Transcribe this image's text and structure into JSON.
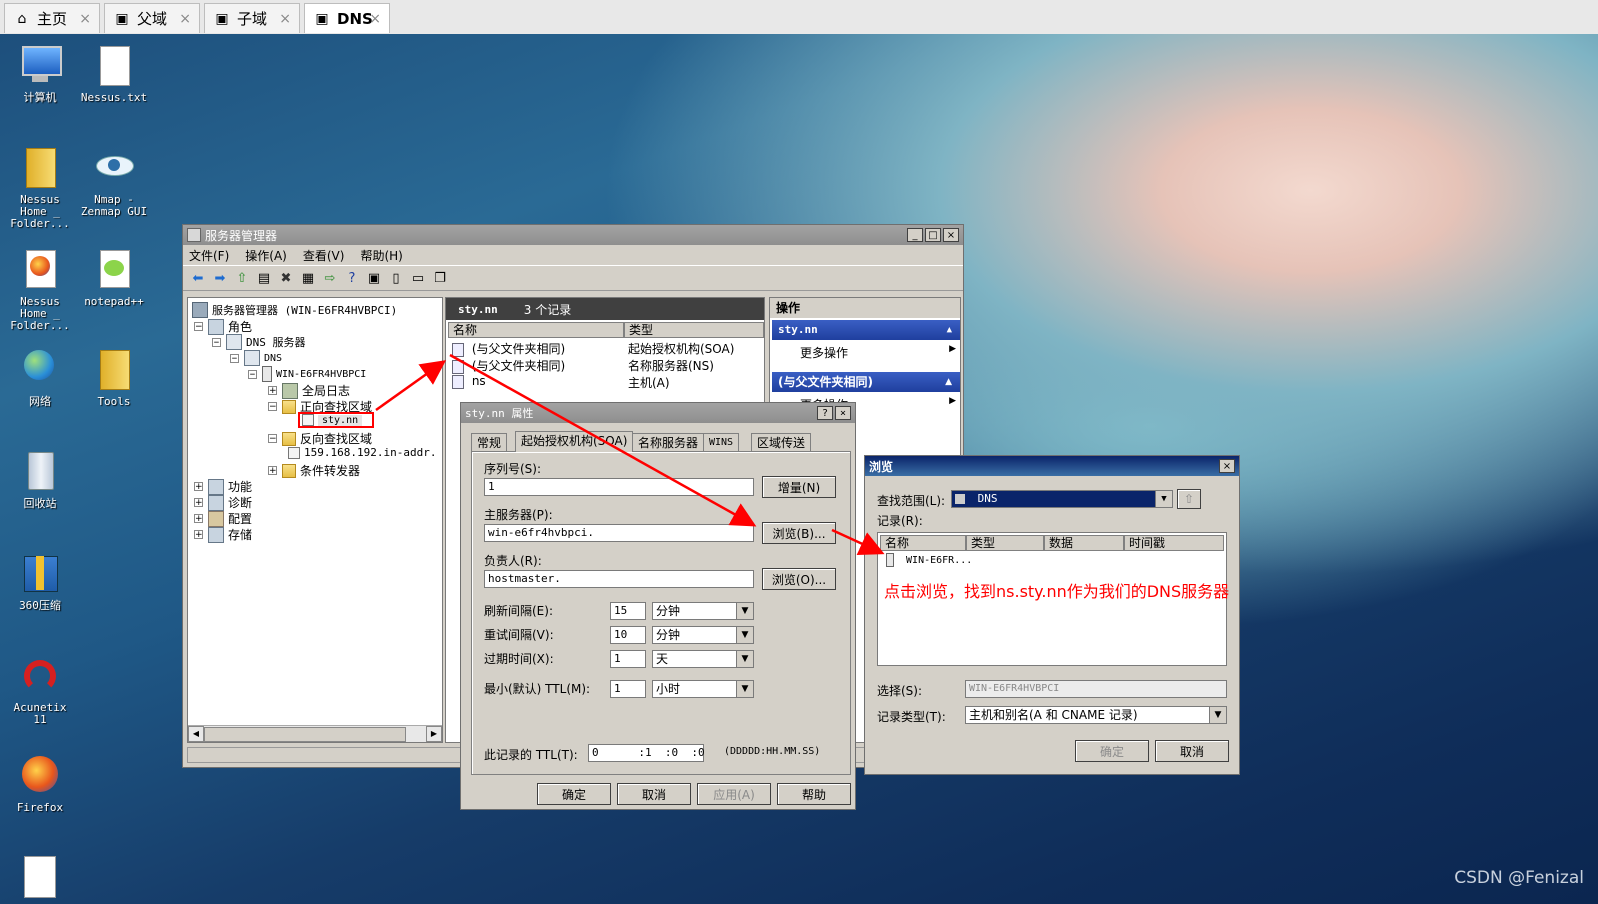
{
  "browser_tabs": [
    {
      "label": "主页",
      "icon": "home-icon",
      "active": false
    },
    {
      "label": "父域",
      "icon": "vm-icon",
      "active": false
    },
    {
      "label": "子域",
      "icon": "vm-icon",
      "active": false
    },
    {
      "label": "DNS",
      "icon": "vm-icon",
      "active": true
    }
  ],
  "desktop_icons": [
    {
      "label": "计算机",
      "icon": "computer-icon"
    },
    {
      "label": "Nessus.txt",
      "icon": "text-file-icon"
    },
    {
      "label": "Nessus Home _ Folder...",
      "icon": "folder-icon"
    },
    {
      "label": "Nmap - Zenmap GUI",
      "icon": "eye-icon"
    },
    {
      "label": "Nessus Home _ Folder...",
      "icon": "firefox-icon"
    },
    {
      "label": "notepad++",
      "icon": "notepad-icon"
    },
    {
      "label": "网络",
      "icon": "network-icon"
    },
    {
      "label": "Tools",
      "icon": "folder-icon"
    },
    {
      "label": "回收站",
      "icon": "recycle-bin-icon"
    },
    {
      "label": "360压缩",
      "icon": "archive-icon"
    },
    {
      "label": "Acunetix 11",
      "icon": "acunetix-icon"
    },
    {
      "label": "Firefox",
      "icon": "firefox-icon"
    }
  ],
  "server_manager": {
    "title": "服务器管理器",
    "menu": [
      "文件(F)",
      "操作(A)",
      "查看(V)",
      "帮助(H)"
    ],
    "tree": {
      "root": "服务器管理器 (WIN-E6FR4HVBPCI)",
      "roles": "角色",
      "dns_service": "DNS 服务器",
      "dns": "DNS",
      "server": "WIN-E6FR4HVBPCI",
      "global_log": "全局日志",
      "forward_zone": "正向查找区域",
      "zone_sty": "sty.nn",
      "reverse_zone": "反向查找区域",
      "reverse_entry": "159.168.192.in-addr.",
      "forwarders": "条件转发器",
      "features": "功能",
      "diagnostics": "诊断",
      "config": "配置",
      "storage": "存储"
    },
    "center": {
      "zone_name": "sty.nn",
      "count": "3 个记录",
      "col_name": "名称",
      "col_type": "类型",
      "records": [
        {
          "name": "(与父文件夹相同)",
          "type": "起始授权机构(SOA)"
        },
        {
          "name": "(与父文件夹相同)",
          "type": "名称服务器(NS)"
        },
        {
          "name": "ns",
          "type": "主机(A)"
        }
      ]
    },
    "actions": {
      "header": "操作",
      "section1": "sty.nn",
      "more1": "更多操作",
      "section2": "(与父文件夹相同)",
      "more2": "更多操作"
    }
  },
  "props_dialog": {
    "title": "sty.nn 属性",
    "tabs": [
      "常规",
      "起始授权机构(SOA)",
      "名称服务器",
      "WINS",
      "区域传送"
    ],
    "serial_label": "序列号(S):",
    "serial_value": "1",
    "increment_btn": "增量(N)",
    "primary_label": "主服务器(P):",
    "primary_value": "win-e6fr4hvbpci.",
    "browse_b": "浏览(B)...",
    "responsible_label": "负责人(R):",
    "responsible_value": "hostmaster.",
    "browse_o": "浏览(O)...",
    "refresh_label": "刷新间隔(E):",
    "refresh_value": "15",
    "refresh_unit": "分钟",
    "retry_label": "重试间隔(V):",
    "retry_value": "10",
    "retry_unit": "分钟",
    "expire_label": "过期时间(X):",
    "expire_value": "1",
    "expire_unit": "天",
    "minttl_label": "最小(默认) TTL(M):",
    "minttl_value": "1",
    "minttl_unit": "小时",
    "ttl_label": "此记录的 TTL(T):",
    "ttl_value": "0      :1  :0  :0",
    "ttl_format": "(DDDDD:HH.MM.SS)",
    "ok": "确定",
    "cancel": "取消",
    "apply": "应用(A)",
    "help": "帮助"
  },
  "browse_dialog": {
    "title": "浏览",
    "scope_label": "查找范围(L):",
    "scope_value": "DNS",
    "records_label": "记录(R):",
    "cols": [
      "名称",
      "类型",
      "数据",
      "时间戳"
    ],
    "item": "WIN-E6FR...",
    "select_label": "选择(S):",
    "select_value": "WIN-E6FR4HVBPCI",
    "type_label": "记录类型(T):",
    "type_value": "主机和别名(A 和 CNAME 记录)",
    "ok": "确定",
    "cancel": "取消"
  },
  "annotation": "点击浏览，找到ns.sty.nn作为我们的DNS服务器",
  "watermark": "CSDN @Fenizal",
  "colors": {
    "annotation": "#ff0000",
    "selection": "#0a246a",
    "actions_header": "#1f3f9e"
  }
}
